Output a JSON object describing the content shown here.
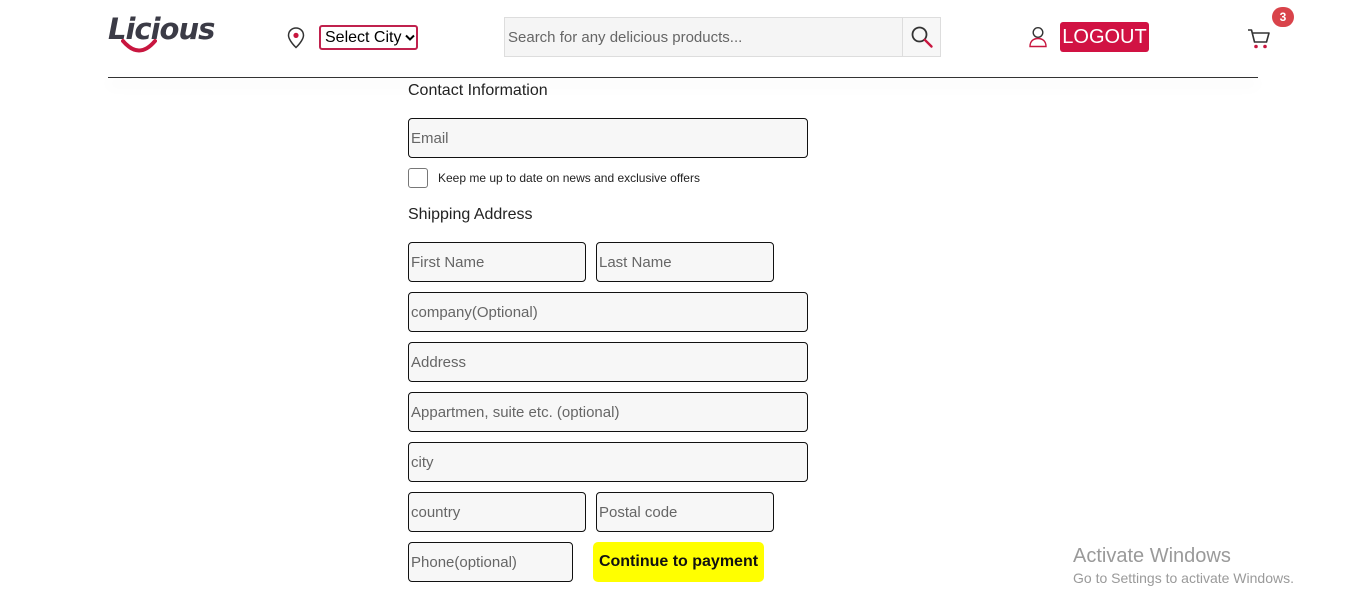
{
  "header": {
    "logo_text": "Licious",
    "city_select_value": "Select City",
    "search_placeholder": "Search for any delicious products...",
    "logout_label": "LOGOUT",
    "cart_count": "3",
    "brand_color": "#d11243"
  },
  "form": {
    "contact_title": "Contact Information",
    "email_placeholder": "Email",
    "newsletter_label": "Keep me up to date on news and exclusive offers",
    "shipping_title": "Shipping Address",
    "first_name_placeholder": "First Name",
    "last_name_placeholder": "Last Name",
    "company_placeholder": "company(Optional)",
    "address_placeholder": "Address",
    "apartment_placeholder": "Appartmen, suite etc. (optional)",
    "city_placeholder": "city",
    "country_placeholder": "country",
    "postal_placeholder": "Postal code",
    "phone_placeholder": "Phone(optional)",
    "continue_label": "Continue to payment",
    "continue_color": "#ffff00"
  },
  "os_watermark": {
    "line1": "Activate Windows",
    "line2": "Go to Settings to activate Windows."
  },
  "icons": [
    "location-pin-icon",
    "chevron-down-icon",
    "search-icon",
    "user-icon",
    "cart-icon"
  ]
}
